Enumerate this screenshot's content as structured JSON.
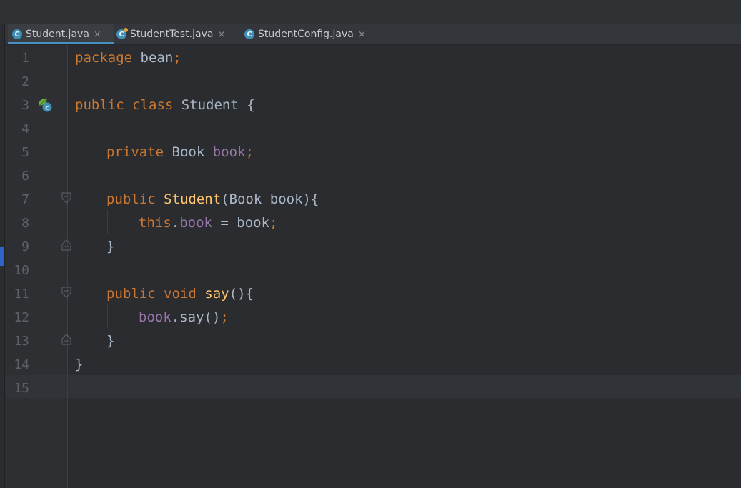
{
  "tabs": [
    {
      "label": "Student.java",
      "icon": "class-icon",
      "active": true
    },
    {
      "label": "StudentTest.java",
      "icon": "test-class-icon",
      "active": false
    },
    {
      "label": "StudentConfig.java",
      "icon": "class-icon",
      "active": false
    }
  ],
  "close_glyph": "×",
  "line_numbers": [
    "1",
    "2",
    "3",
    "4",
    "5",
    "6",
    "7",
    "8",
    "9",
    "10",
    "11",
    "12",
    "13",
    "14",
    "15"
  ],
  "code": {
    "l1": {
      "t1": "package",
      "t2": " bean",
      "t3": ";"
    },
    "l3": {
      "t1": "public class",
      "t2": " Student {"
    },
    "l5": {
      "t1": "private",
      "t2": " Book ",
      "t3": "book",
      "t4": ";"
    },
    "l7": {
      "t1": "public",
      "t2": " ",
      "t3": "Student",
      "t4": "(Book book){"
    },
    "l8": {
      "t1": "this",
      "t2": ".",
      "t3": "book",
      "t4": " = book",
      "t5": ";"
    },
    "l9": {
      "t1": "}"
    },
    "l11": {
      "t1": "public void",
      "t2": " ",
      "t3": "say",
      "t4": "(){"
    },
    "l12": {
      "t1": "book",
      "t2": ".say()",
      "t3": ";"
    },
    "l13": {
      "t1": "}"
    },
    "l14": {
      "t1": "}"
    }
  },
  "colors": {
    "keyword": "#cc7832",
    "field": "#9876aa",
    "method": "#ffc66d",
    "text": "#a9b7c6"
  }
}
